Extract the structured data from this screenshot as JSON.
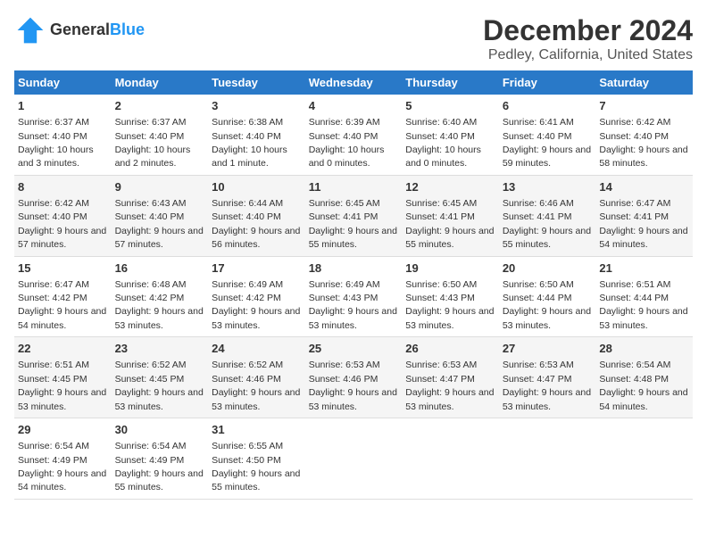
{
  "header": {
    "logo_line1": "General",
    "logo_line2": "Blue",
    "title": "December 2024",
    "subtitle": "Pedley, California, United States"
  },
  "days_of_week": [
    "Sunday",
    "Monday",
    "Tuesday",
    "Wednesday",
    "Thursday",
    "Friday",
    "Saturday"
  ],
  "weeks": [
    [
      {
        "day": "1",
        "sunrise": "Sunrise: 6:37 AM",
        "sunset": "Sunset: 4:40 PM",
        "daylight": "Daylight: 10 hours and 3 minutes."
      },
      {
        "day": "2",
        "sunrise": "Sunrise: 6:37 AM",
        "sunset": "Sunset: 4:40 PM",
        "daylight": "Daylight: 10 hours and 2 minutes."
      },
      {
        "day": "3",
        "sunrise": "Sunrise: 6:38 AM",
        "sunset": "Sunset: 4:40 PM",
        "daylight": "Daylight: 10 hours and 1 minute."
      },
      {
        "day": "4",
        "sunrise": "Sunrise: 6:39 AM",
        "sunset": "Sunset: 4:40 PM",
        "daylight": "Daylight: 10 hours and 0 minutes."
      },
      {
        "day": "5",
        "sunrise": "Sunrise: 6:40 AM",
        "sunset": "Sunset: 4:40 PM",
        "daylight": "Daylight: 10 hours and 0 minutes."
      },
      {
        "day": "6",
        "sunrise": "Sunrise: 6:41 AM",
        "sunset": "Sunset: 4:40 PM",
        "daylight": "Daylight: 9 hours and 59 minutes."
      },
      {
        "day": "7",
        "sunrise": "Sunrise: 6:42 AM",
        "sunset": "Sunset: 4:40 PM",
        "daylight": "Daylight: 9 hours and 58 minutes."
      }
    ],
    [
      {
        "day": "8",
        "sunrise": "Sunrise: 6:42 AM",
        "sunset": "Sunset: 4:40 PM",
        "daylight": "Daylight: 9 hours and 57 minutes."
      },
      {
        "day": "9",
        "sunrise": "Sunrise: 6:43 AM",
        "sunset": "Sunset: 4:40 PM",
        "daylight": "Daylight: 9 hours and 57 minutes."
      },
      {
        "day": "10",
        "sunrise": "Sunrise: 6:44 AM",
        "sunset": "Sunset: 4:40 PM",
        "daylight": "Daylight: 9 hours and 56 minutes."
      },
      {
        "day": "11",
        "sunrise": "Sunrise: 6:45 AM",
        "sunset": "Sunset: 4:41 PM",
        "daylight": "Daylight: 9 hours and 55 minutes."
      },
      {
        "day": "12",
        "sunrise": "Sunrise: 6:45 AM",
        "sunset": "Sunset: 4:41 PM",
        "daylight": "Daylight: 9 hours and 55 minutes."
      },
      {
        "day": "13",
        "sunrise": "Sunrise: 6:46 AM",
        "sunset": "Sunset: 4:41 PM",
        "daylight": "Daylight: 9 hours and 55 minutes."
      },
      {
        "day": "14",
        "sunrise": "Sunrise: 6:47 AM",
        "sunset": "Sunset: 4:41 PM",
        "daylight": "Daylight: 9 hours and 54 minutes."
      }
    ],
    [
      {
        "day": "15",
        "sunrise": "Sunrise: 6:47 AM",
        "sunset": "Sunset: 4:42 PM",
        "daylight": "Daylight: 9 hours and 54 minutes."
      },
      {
        "day": "16",
        "sunrise": "Sunrise: 6:48 AM",
        "sunset": "Sunset: 4:42 PM",
        "daylight": "Daylight: 9 hours and 53 minutes."
      },
      {
        "day": "17",
        "sunrise": "Sunrise: 6:49 AM",
        "sunset": "Sunset: 4:42 PM",
        "daylight": "Daylight: 9 hours and 53 minutes."
      },
      {
        "day": "18",
        "sunrise": "Sunrise: 6:49 AM",
        "sunset": "Sunset: 4:43 PM",
        "daylight": "Daylight: 9 hours and 53 minutes."
      },
      {
        "day": "19",
        "sunrise": "Sunrise: 6:50 AM",
        "sunset": "Sunset: 4:43 PM",
        "daylight": "Daylight: 9 hours and 53 minutes."
      },
      {
        "day": "20",
        "sunrise": "Sunrise: 6:50 AM",
        "sunset": "Sunset: 4:44 PM",
        "daylight": "Daylight: 9 hours and 53 minutes."
      },
      {
        "day": "21",
        "sunrise": "Sunrise: 6:51 AM",
        "sunset": "Sunset: 4:44 PM",
        "daylight": "Daylight: 9 hours and 53 minutes."
      }
    ],
    [
      {
        "day": "22",
        "sunrise": "Sunrise: 6:51 AM",
        "sunset": "Sunset: 4:45 PM",
        "daylight": "Daylight: 9 hours and 53 minutes."
      },
      {
        "day": "23",
        "sunrise": "Sunrise: 6:52 AM",
        "sunset": "Sunset: 4:45 PM",
        "daylight": "Daylight: 9 hours and 53 minutes."
      },
      {
        "day": "24",
        "sunrise": "Sunrise: 6:52 AM",
        "sunset": "Sunset: 4:46 PM",
        "daylight": "Daylight: 9 hours and 53 minutes."
      },
      {
        "day": "25",
        "sunrise": "Sunrise: 6:53 AM",
        "sunset": "Sunset: 4:46 PM",
        "daylight": "Daylight: 9 hours and 53 minutes."
      },
      {
        "day": "26",
        "sunrise": "Sunrise: 6:53 AM",
        "sunset": "Sunset: 4:47 PM",
        "daylight": "Daylight: 9 hours and 53 minutes."
      },
      {
        "day": "27",
        "sunrise": "Sunrise: 6:53 AM",
        "sunset": "Sunset: 4:47 PM",
        "daylight": "Daylight: 9 hours and 53 minutes."
      },
      {
        "day": "28",
        "sunrise": "Sunrise: 6:54 AM",
        "sunset": "Sunset: 4:48 PM",
        "daylight": "Daylight: 9 hours and 54 minutes."
      }
    ],
    [
      {
        "day": "29",
        "sunrise": "Sunrise: 6:54 AM",
        "sunset": "Sunset: 4:49 PM",
        "daylight": "Daylight: 9 hours and 54 minutes."
      },
      {
        "day": "30",
        "sunrise": "Sunrise: 6:54 AM",
        "sunset": "Sunset: 4:49 PM",
        "daylight": "Daylight: 9 hours and 55 minutes."
      },
      {
        "day": "31",
        "sunrise": "Sunrise: 6:55 AM",
        "sunset": "Sunset: 4:50 PM",
        "daylight": "Daylight: 9 hours and 55 minutes."
      },
      {
        "day": "",
        "sunrise": "",
        "sunset": "",
        "daylight": ""
      },
      {
        "day": "",
        "sunrise": "",
        "sunset": "",
        "daylight": ""
      },
      {
        "day": "",
        "sunrise": "",
        "sunset": "",
        "daylight": ""
      },
      {
        "day": "",
        "sunrise": "",
        "sunset": "",
        "daylight": ""
      }
    ]
  ]
}
